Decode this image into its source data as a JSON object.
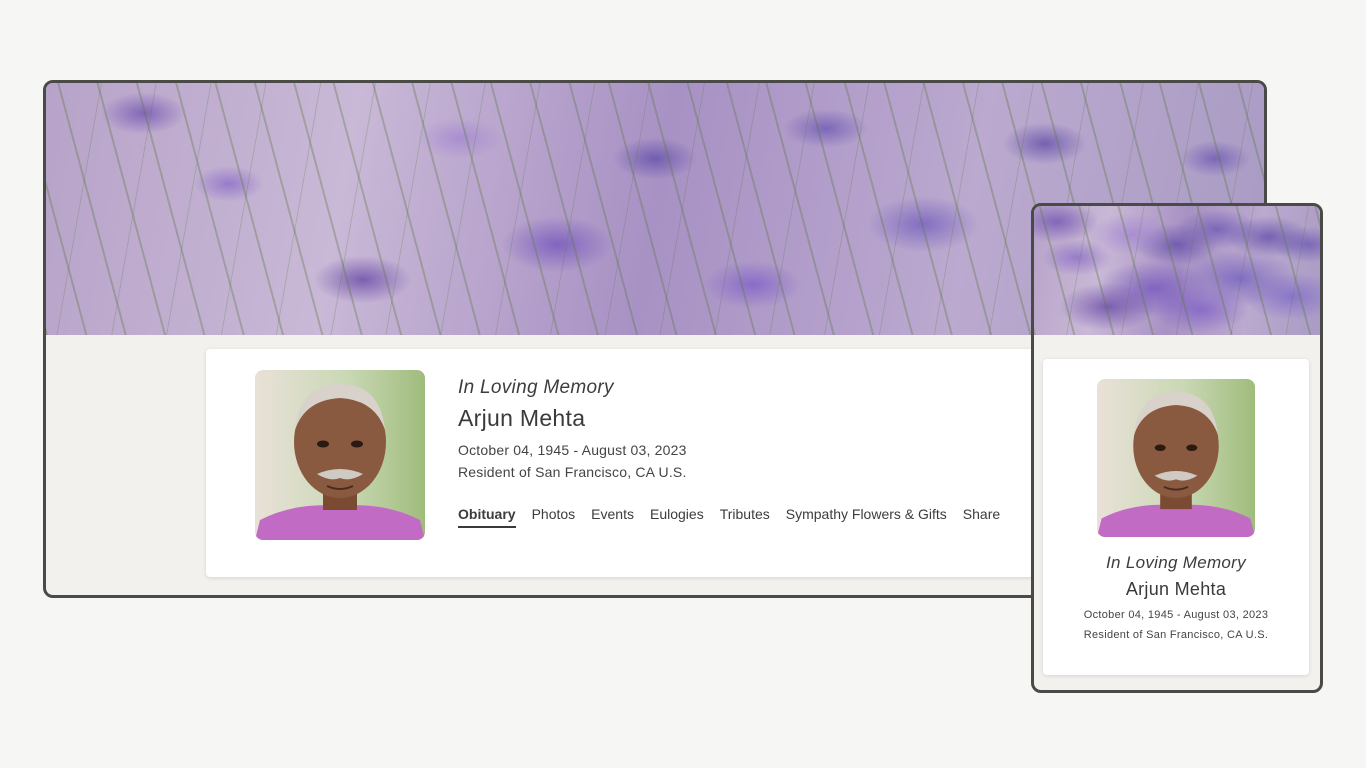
{
  "memorial": {
    "tagline": "In Loving Memory",
    "name": "Arjun Mehta",
    "dates": "October 04, 1945 - August 03, 2023",
    "residence": "Resident of San Francisco, CA U.S."
  },
  "nav": {
    "tabs": [
      {
        "label": "Obituary",
        "active": true
      },
      {
        "label": "Photos",
        "active": false
      },
      {
        "label": "Events",
        "active": false
      },
      {
        "label": "Eulogies",
        "active": false
      },
      {
        "label": "Tributes",
        "active": false
      },
      {
        "label": "Sympathy Flowers & Gifts",
        "active": false
      },
      {
        "label": "Share",
        "active": false
      }
    ]
  },
  "colors": {
    "frame_border": "#4a4b46",
    "page_background": "#f6f6f5",
    "card_background": "#ffffff",
    "banner_accent": "#a891c4"
  }
}
